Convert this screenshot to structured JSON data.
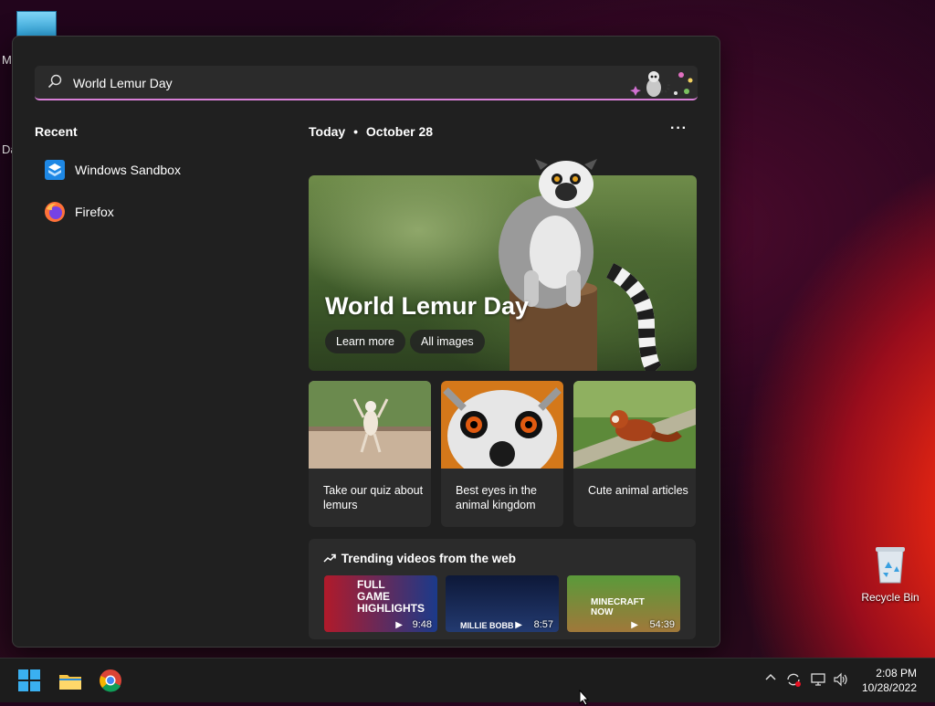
{
  "desktop": {
    "partial_labels": [
      "M",
      "Da"
    ],
    "recycle_bin_label": "Recycle Bin"
  },
  "search": {
    "value": "World Lemur Day",
    "placeholder": ""
  },
  "recent": {
    "title": "Recent",
    "items": [
      {
        "label": "Windows Sandbox",
        "icon": "windows-sandbox-icon"
      },
      {
        "label": "Firefox",
        "icon": "firefox-icon"
      }
    ]
  },
  "highlights": {
    "date_label": "Today",
    "separator": "•",
    "date": "October 28",
    "more": "···",
    "hero": {
      "title": "World Lemur Day",
      "buttons": [
        "Learn more",
        "All images"
      ]
    },
    "cards": [
      {
        "text": "Take our quiz about lemurs"
      },
      {
        "text": "Best eyes in the animal kingdom"
      },
      {
        "text": "Cute animal articles"
      }
    ],
    "trending": {
      "title": "Trending videos from the web",
      "videos": [
        {
          "caption": "FULL GAME HIGHLIGHTS",
          "duration": "9:48"
        },
        {
          "caption": "MILLIE BOBB",
          "duration": "8:57"
        },
        {
          "caption": "MINECRAFT NOW",
          "duration": "54:39"
        }
      ]
    }
  },
  "taskbar": {
    "time": "2:08 PM",
    "date": "10/28/2022"
  },
  "colors": {
    "accent_underline": "#d77fd6",
    "panel_bg": "#202020",
    "card_bg": "#2b2b2b"
  }
}
